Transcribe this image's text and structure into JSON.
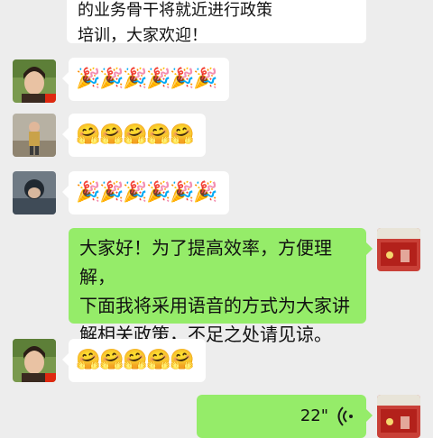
{
  "messages": [
    {
      "id": "m0",
      "side": "left",
      "text": "市税务局辖区各税务所和税费服务中心的业务骨干将就近进行政策\n培训，大家欢迎！"
    },
    {
      "id": "m1",
      "side": "left",
      "emoji": [
        "🎉",
        "🎉",
        "🎉",
        "🎉",
        "🎉",
        "🎉"
      ]
    },
    {
      "id": "m2",
      "side": "left",
      "emoji": [
        "🤗",
        "🤗",
        "🤗",
        "🤗",
        "🤗"
      ]
    },
    {
      "id": "m3",
      "side": "left",
      "emoji": [
        "🎉",
        "🎉",
        "🎉",
        "🎉",
        "🎉",
        "🎉"
      ]
    },
    {
      "id": "m4",
      "side": "right",
      "text": "大家好！为了提高效率，方便理解，\n下面我将采用语音的方式为大家讲\n解相关政策，不足之处请见谅。"
    },
    {
      "id": "m5",
      "side": "left",
      "emoji": [
        "🤗",
        "🤗",
        "🤗",
        "🤗",
        "🤗"
      ]
    },
    {
      "id": "m6",
      "side": "right",
      "voice": "22\""
    }
  ],
  "colors": {
    "background": "#ededed",
    "bubble_self": "#95ec69",
    "bubble_other": "#ffffff"
  },
  "icons": {
    "voice": "voice-wave-icon"
  }
}
